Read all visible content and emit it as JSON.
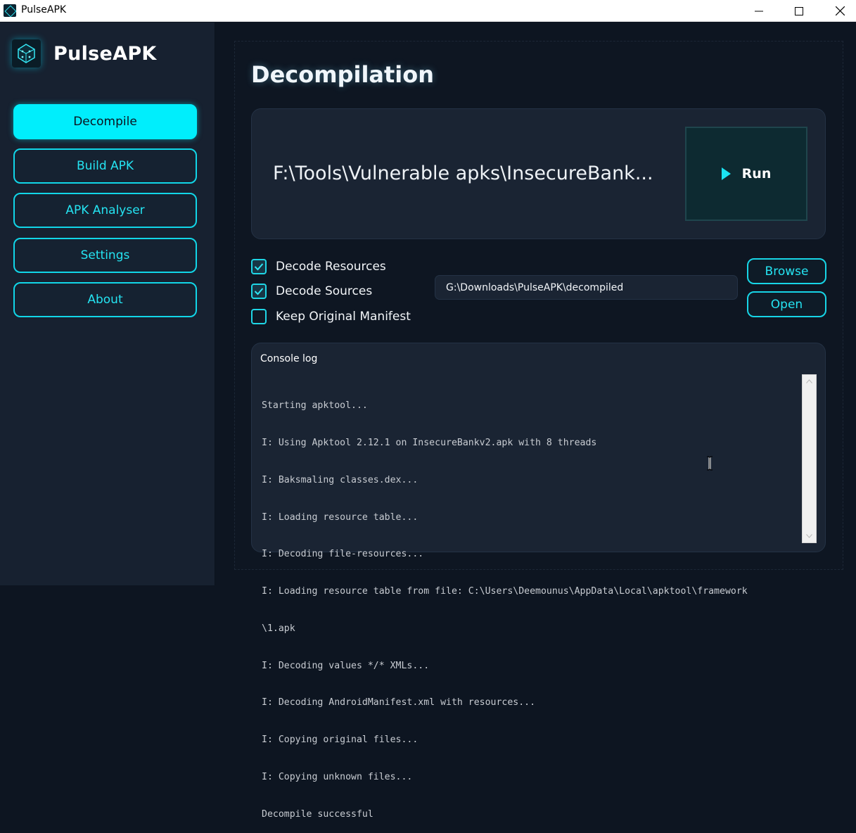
{
  "window": {
    "title": "PulseAPK",
    "controls": [
      "minimize-icon",
      "maximize-icon",
      "close-icon"
    ]
  },
  "sidebar": {
    "brand": "PulseAPK",
    "items": [
      {
        "label": "Decompile",
        "active": true
      },
      {
        "label": "Build APK",
        "active": false
      },
      {
        "label": "APK Analyser",
        "active": false
      },
      {
        "label": "Settings",
        "active": false
      },
      {
        "label": "About",
        "active": false
      }
    ]
  },
  "main": {
    "title": "Decompilation",
    "apk_path": "F:\\Tools\\Vulnerable apks\\InsecureBank...",
    "run_label": "Run",
    "options": [
      {
        "label": "Decode Resources",
        "checked": true
      },
      {
        "label": "Decode Sources",
        "checked": true
      },
      {
        "label": "Keep Original Manifest",
        "checked": false
      }
    ],
    "output_dir": "G:\\Downloads\\PulseAPK\\decompiled",
    "browse_label": "Browse",
    "open_label": "Open",
    "console": {
      "title": "Console log",
      "lines": [
        "Starting apktool...",
        "I: Using Apktool 2.12.1 on InsecureBankv2.apk with 8 threads",
        "I: Baksmaling classes.dex...",
        "I: Loading resource table...",
        "I: Decoding file-resources...",
        "I: Loading resource table from file: C:\\Users\\Deemounus\\AppData\\Local\\apktool\\framework",
        "\\1.apk",
        "I: Decoding values */* XMLs...",
        "I: Decoding AndroidManifest.xml with resources...",
        "I: Copying original files...",
        "I: Copying unknown files...",
        "Decompile successful"
      ]
    }
  },
  "colors": {
    "accent": "#00eefc",
    "background": "#0d1521",
    "sidebar": "#172130",
    "card": "#1a2433"
  }
}
